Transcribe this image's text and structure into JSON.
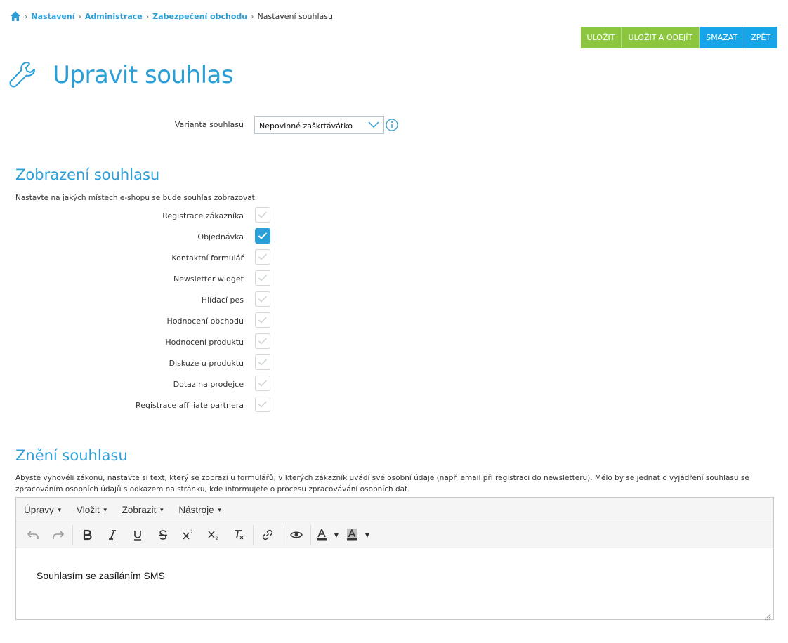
{
  "breadcrumb": {
    "items": [
      "Nastavení",
      "Administrace",
      "Zabezpečení obchodu"
    ],
    "current": "Nastavení souhlasu"
  },
  "actions": {
    "save": "ULOŽIT",
    "save_exit": "ULOŽIT A ODEJÍT",
    "delete": "SMAZAT",
    "back": "ZPĚT"
  },
  "page": {
    "title": "Upravit souhlas"
  },
  "variant": {
    "label": "Varianta souhlasu",
    "value": "Nepovinné zaškrtávátko"
  },
  "display_section": {
    "title": "Zobrazení souhlasu",
    "description": "Nastavte na jakých místech e-shopu se bude souhlas zobrazovat.",
    "items": [
      {
        "label": "Registrace zákazníka",
        "checked": false
      },
      {
        "label": "Objednávka",
        "checked": true
      },
      {
        "label": "Kontaktní formulář",
        "checked": false
      },
      {
        "label": "Newsletter widget",
        "checked": false
      },
      {
        "label": "Hlídací pes",
        "checked": false
      },
      {
        "label": "Hodnocení obchodu",
        "checked": false
      },
      {
        "label": "Hodnocení produktu",
        "checked": false
      },
      {
        "label": "Diskuze u produktu",
        "checked": false
      },
      {
        "label": "Dotaz na prodejce",
        "checked": false
      },
      {
        "label": "Registrace affiliate partnera",
        "checked": false
      }
    ]
  },
  "text_section": {
    "title": "Znění souhlasu",
    "description": "Abyste vyhověli zákonu, nastavte si text, který se zobrazí u formulářů, v kterých zákazník uvádí své osobní údaje (např. email při registraci do newsletteru). Mělo by se jednat o vyjádření souhlasu se zpracováním osobních údajů s odkazem na stránku, kde informujete o procesu zpracovávání osobních dat."
  },
  "editor": {
    "menu": [
      "Úpravy",
      "Vložit",
      "Zobrazit",
      "Nástroje"
    ],
    "content": "Souhlasím se zasíláním SMS"
  },
  "colors": {
    "accent": "#2a9fd8",
    "green": "#8cc63f",
    "blue": "#16a5e8"
  }
}
